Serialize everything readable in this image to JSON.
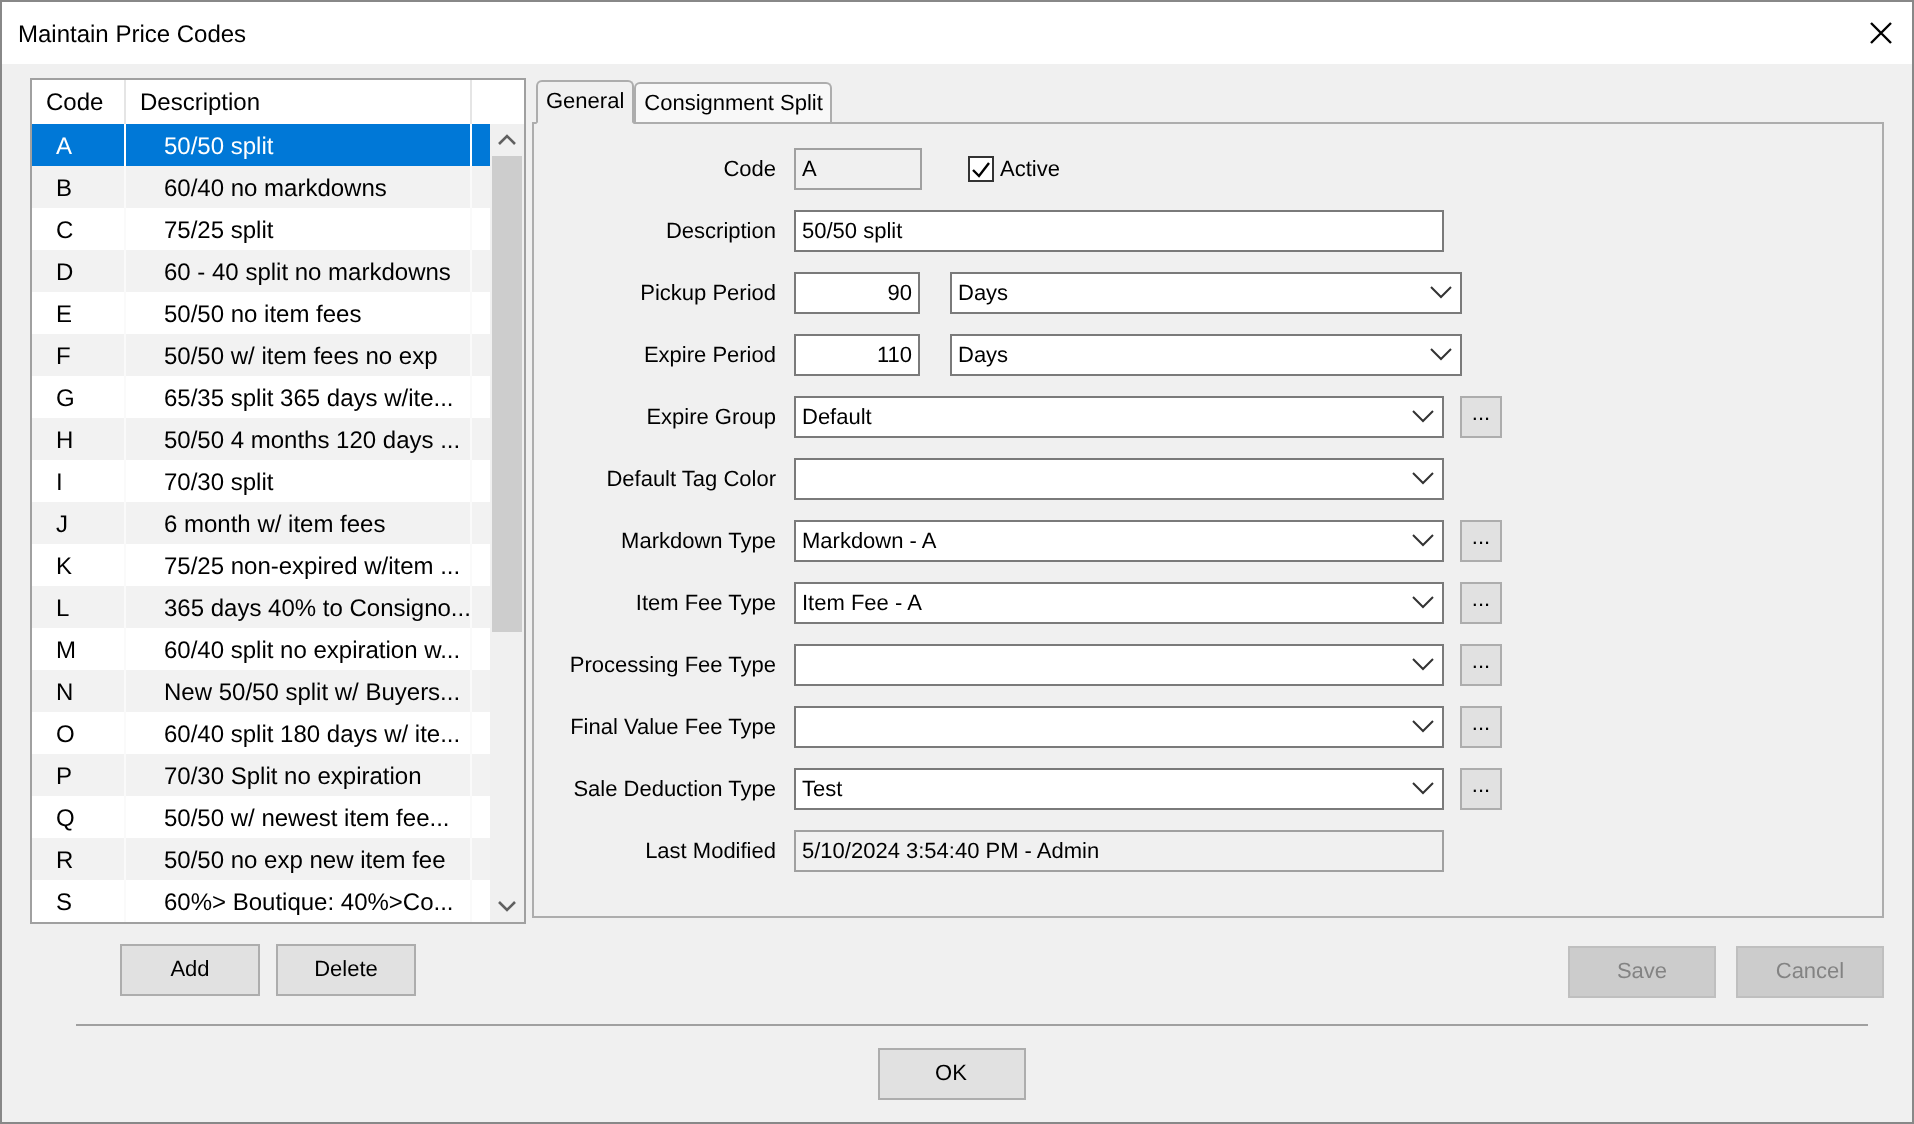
{
  "window": {
    "title": "Maintain Price Codes"
  },
  "list": {
    "columns": [
      "Code",
      "Description"
    ],
    "rows": [
      {
        "code": "A",
        "description": "50/50 split",
        "selected": true
      },
      {
        "code": "B",
        "description": "60/40 no markdowns",
        "selected": false
      },
      {
        "code": "C",
        "description": "75/25 split",
        "selected": false
      },
      {
        "code": "D",
        "description": "60 - 40 split no markdowns",
        "selected": false
      },
      {
        "code": "E",
        "description": "50/50 no item fees",
        "selected": false
      },
      {
        "code": "F",
        "description": "50/50 w/ item fees no exp",
        "selected": false
      },
      {
        "code": "G",
        "description": "65/35 split 365 days w/ite...",
        "selected": false
      },
      {
        "code": "H",
        "description": "50/50 4 months 120 days ...",
        "selected": false
      },
      {
        "code": "I",
        "description": "70/30 split",
        "selected": false
      },
      {
        "code": "J",
        "description": "6 month w/ item fees",
        "selected": false
      },
      {
        "code": "K",
        "description": "75/25 non-expired w/item ...",
        "selected": false
      },
      {
        "code": "L",
        "description": "365 days 40% to Consigno...",
        "selected": false
      },
      {
        "code": "M",
        "description": "60/40 split no expiration w...",
        "selected": false
      },
      {
        "code": "N",
        "description": "New 50/50 split w/ Buyers...",
        "selected": false
      },
      {
        "code": "O",
        "description": "60/40 split 180 days w/ ite...",
        "selected": false
      },
      {
        "code": "P",
        "description": "70/30 Split no expiration",
        "selected": false
      },
      {
        "code": "Q",
        "description": "50/50 w/ newest item fee...",
        "selected": false
      },
      {
        "code": "R",
        "description": "50/50 no exp new item fee",
        "selected": false
      },
      {
        "code": "S",
        "description": "60%> Boutique: 40%>Co...",
        "selected": false
      }
    ],
    "buttons": [
      {
        "label": "Add",
        "disabled": false
      },
      {
        "label": "Delete",
        "disabled": false
      }
    ]
  },
  "tabs": [
    {
      "label": "General",
      "selected": true
    },
    {
      "label": "Consignment Split",
      "selected": false
    }
  ],
  "form": [
    {
      "kind": "code",
      "label": "Code",
      "value": "A",
      "checkbox": {
        "label": "Active",
        "checked": true
      }
    },
    {
      "kind": "text",
      "label": "Description",
      "value": "50/50 split"
    },
    {
      "kind": "period",
      "label": "Pickup Period",
      "value": "90",
      "unit": "Days"
    },
    {
      "kind": "period",
      "label": "Expire Period",
      "value": "110",
      "unit": "Days"
    },
    {
      "kind": "select",
      "label": "Expire Group",
      "value": "Default",
      "more_button": "..."
    },
    {
      "kind": "select",
      "label": "Default Tag Color"
    },
    {
      "kind": "select",
      "label": "Markdown Type",
      "value": "Markdown - A",
      "more_button": "..."
    },
    {
      "kind": "select",
      "label": "Item Fee Type",
      "value": "Item Fee - A",
      "more_button": "..."
    },
    {
      "kind": "select",
      "label": "Processing Fee Type",
      "more_button": "..."
    },
    {
      "kind": "select",
      "label": "Final Value Fee Type",
      "more_button": "..."
    },
    {
      "kind": "select",
      "label": "Sale Deduction Type",
      "value": "Test",
      "more_button": "..."
    },
    {
      "kind": "readonly",
      "label": "Last Modified",
      "value": "5/10/2024 3:54:40 PM - Admin"
    }
  ],
  "form_buttons": [
    {
      "label": "Save",
      "disabled": true
    },
    {
      "label": "Cancel",
      "disabled": true
    }
  ],
  "footer_buttons": [
    {
      "label": "OK",
      "disabled": false
    }
  ]
}
